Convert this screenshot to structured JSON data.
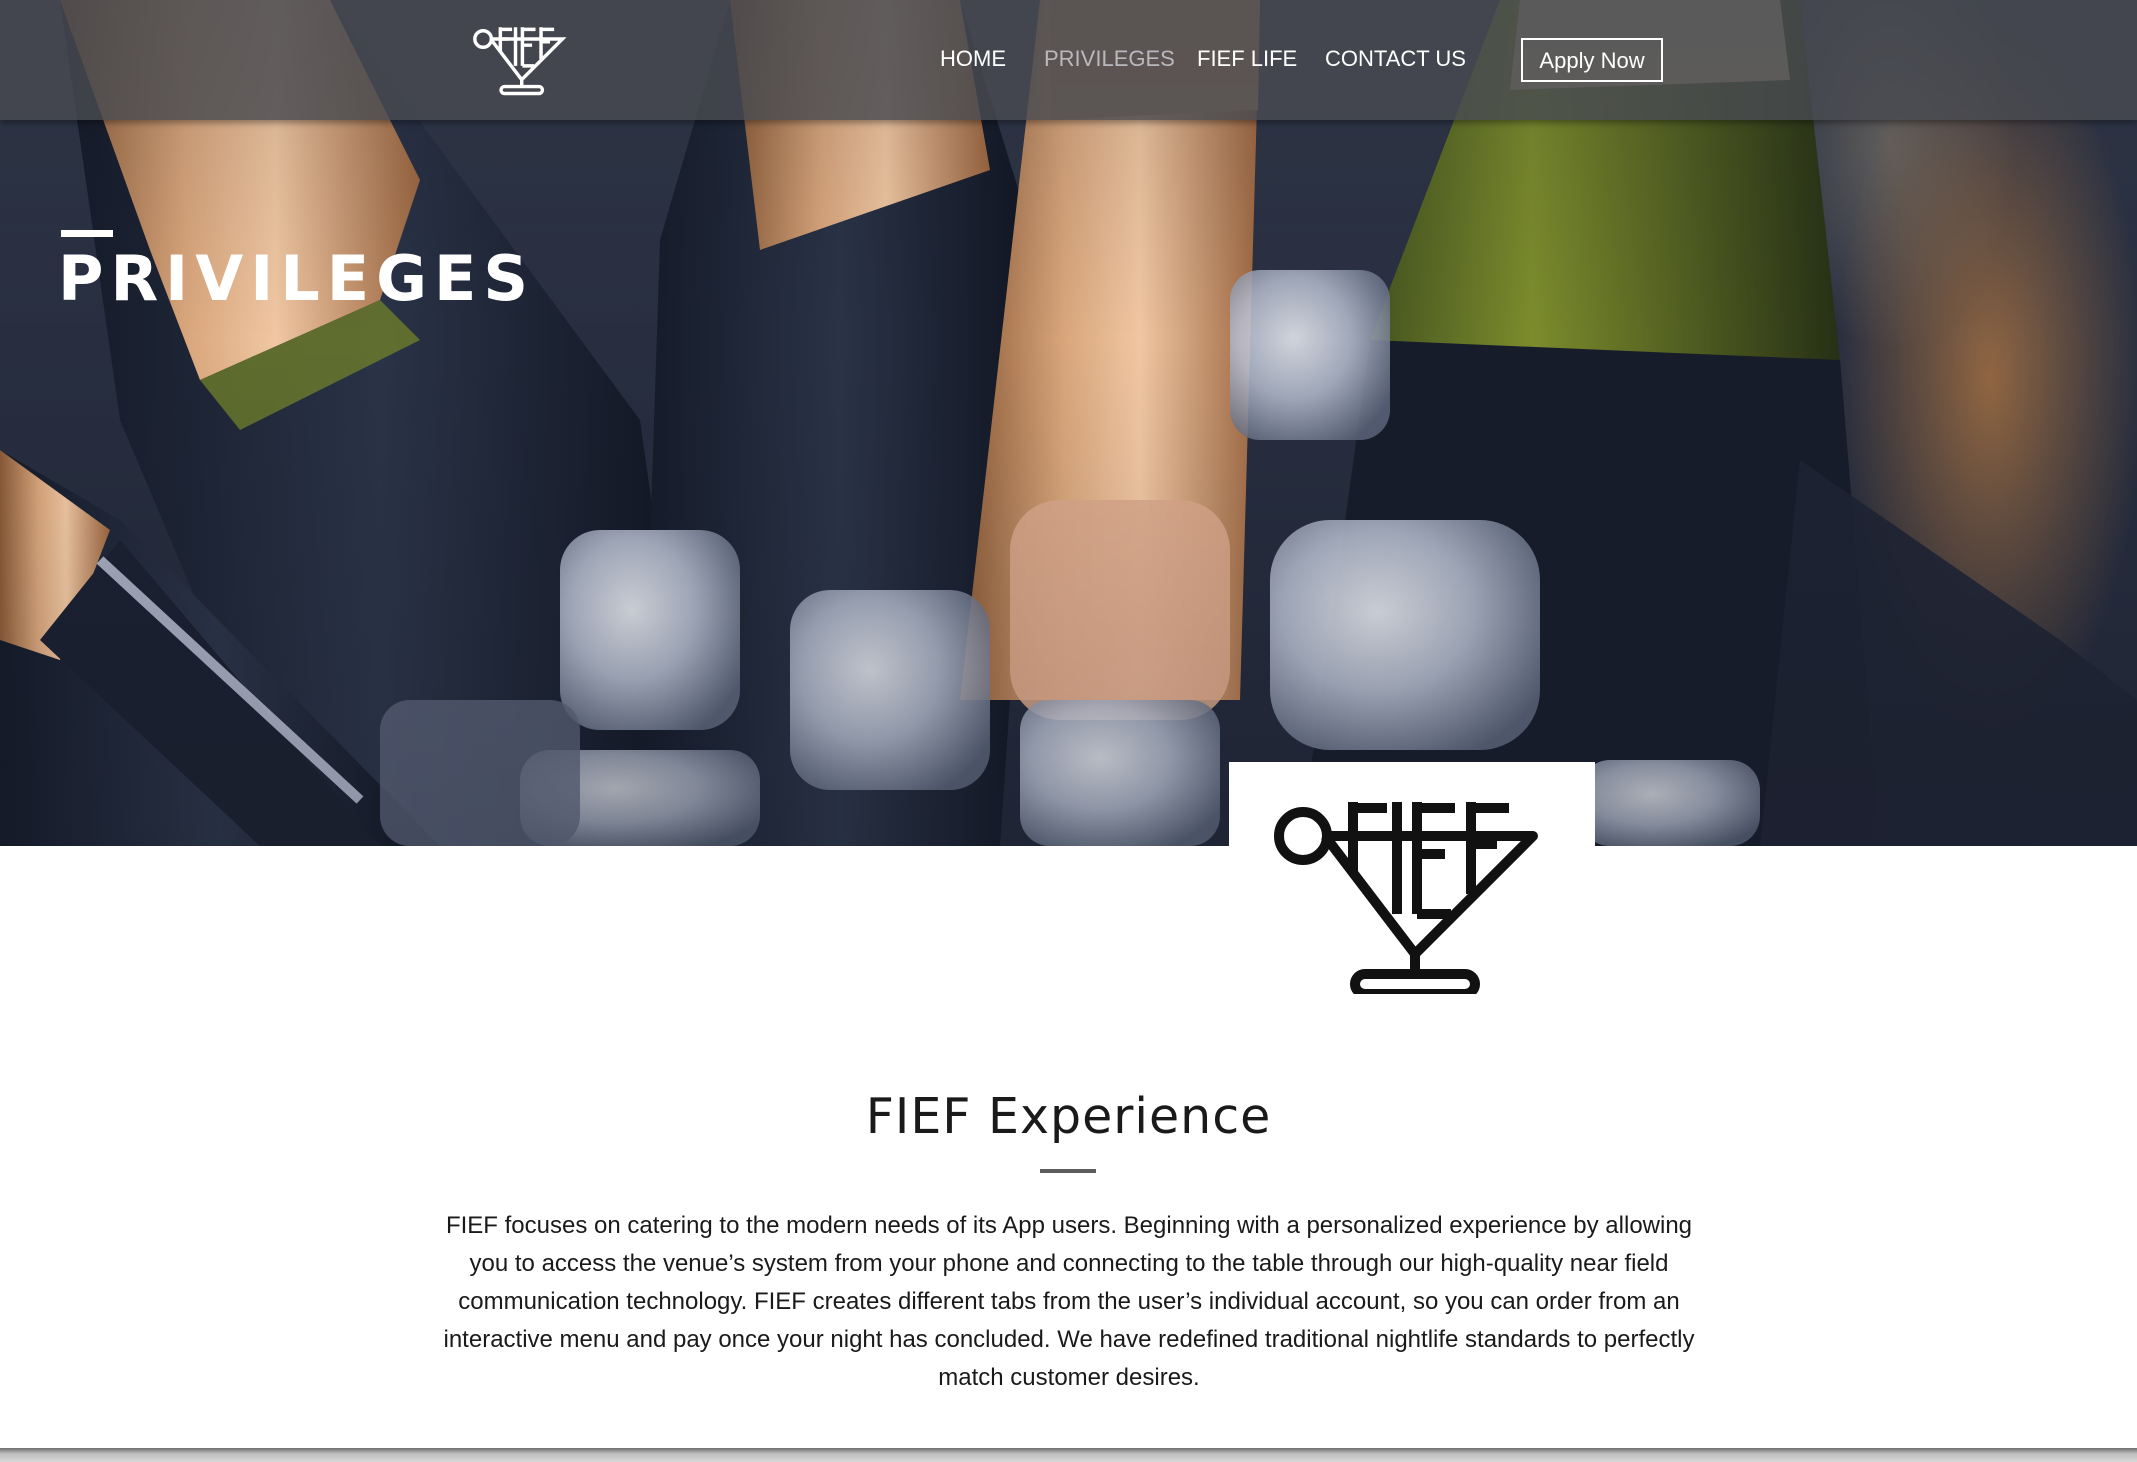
{
  "header": {
    "logo_icon": "fief-martini-logo",
    "nav": [
      {
        "label": "HOME",
        "active": false
      },
      {
        "label": "PRIVILEGES",
        "active": true
      },
      {
        "label": "FIEF LIFE",
        "active": false
      },
      {
        "label": "CONTACT US",
        "active": false
      }
    ],
    "apply_label": "Apply Now"
  },
  "hero": {
    "title": "PRIVILEGES",
    "image": "champagne-bottles-in-ice-bucket"
  },
  "logo": {
    "icon": "fief-martini-logo"
  },
  "section": {
    "heading": "FIEF Experience",
    "body": "FIEF focuses on catering to the modern needs of its App users. Beginning with a personalized experience by allowing you to access the venue’s system from your phone and connecting to the table through our high-quality near field communication technology. FIEF creates different tabs from the user’s individual account, so you can order from an interactive menu and pay once your night has concluded. We have redefined traditional nightlife standards to perfectly match customer desires."
  },
  "colors": {
    "header_bg": "#484a50",
    "nav_active": "#b9b9bd",
    "text": "#1a1a1a",
    "divider": "#5d5d5d",
    "accent_gold": "#c98f5f"
  }
}
